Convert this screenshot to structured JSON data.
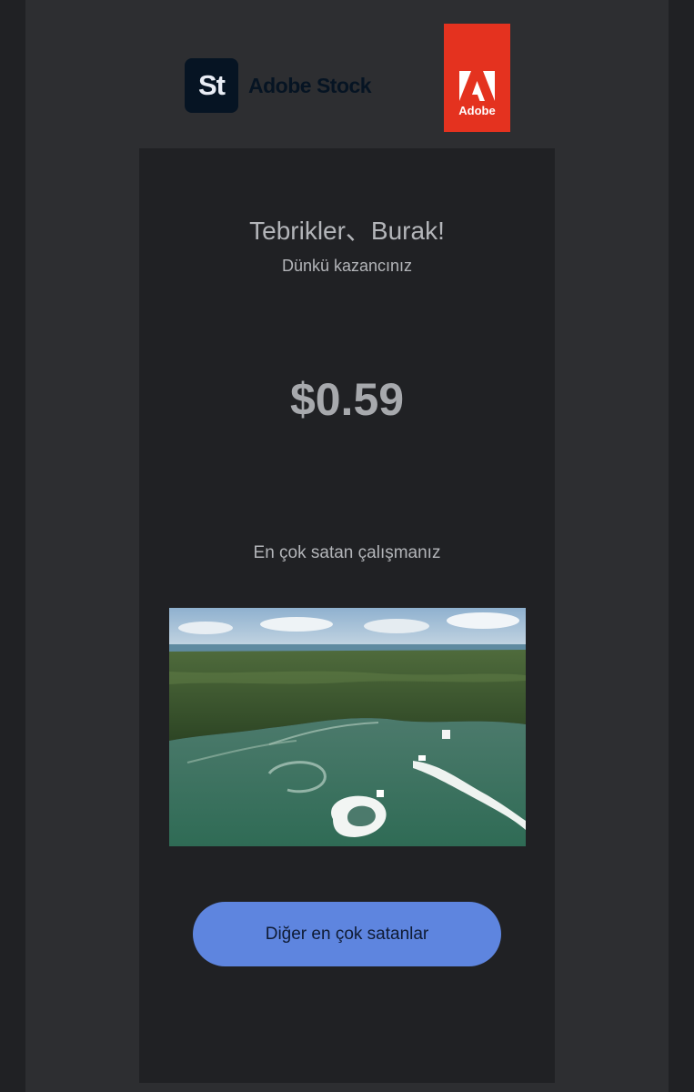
{
  "header": {
    "stock_logo_badge": "St",
    "stock_logo_text": "Adobe Stock",
    "adobe_logo_text": "Adobe"
  },
  "email": {
    "greeting": "Tebrikler、Burak!",
    "subtitle": "Dünkü kazancınız",
    "earnings": "$0.59",
    "bestseller_label": "En çok satan çalışmanız",
    "cta_label": "Diğer en çok satanlar"
  },
  "colors": {
    "background": "#202124",
    "frame": "#2d2e31",
    "adobe_red": "#e4321f",
    "stock_navy": "#061423",
    "cta_blue": "#5e85df"
  }
}
